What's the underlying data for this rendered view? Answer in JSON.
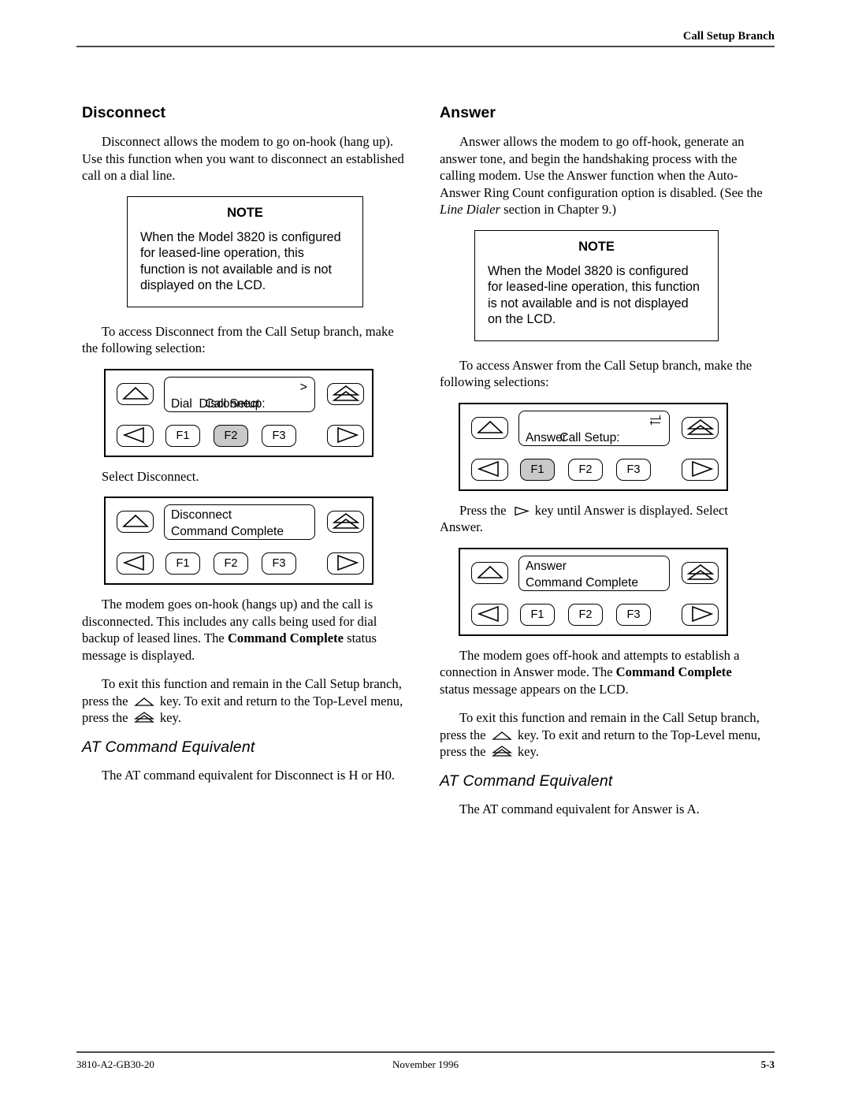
{
  "header": {
    "title": "Call Setup Branch"
  },
  "footer": {
    "doc_number": "3810-A2-GB30-20",
    "date": "November 1996",
    "page_number": "5-3"
  },
  "note_box": {
    "title": "NOTE",
    "text": "When the Model 3820 is configured for leased-line operation, this function is not available and is not displayed on the LCD."
  },
  "left_column": {
    "heading": "Disconnect",
    "intro": "Disconnect allows the modem to go on-hook (hang up). Use this function when you want to disconnect an established call on a dial line.",
    "access_text": "To access Disconnect from the Call Setup branch, make the following selection:",
    "panel1": {
      "lcd_line1": "Call Setup:",
      "lcd_line1_mark": ">",
      "lcd_line2": "Dial  Disconnect",
      "f1": "F1",
      "f2": "F2",
      "f3": "F3",
      "selected_key": "F2"
    },
    "select_text": "Select Disconnect.",
    "panel2": {
      "lcd_line1": "Disconnect",
      "lcd_line2": "Command Complete",
      "f1": "F1",
      "f2": "F2",
      "f3": "F3",
      "selected_key": ""
    },
    "result_before_bold": "The modem goes on-hook (hangs up) and the call is disconnected. This includes any calls being used for dial backup of leased lines. The ",
    "result_bold": "Command Complete",
    "result_after_bold": " status message is displayed.",
    "exit_part1": "To exit this function and remain in the Call Setup branch, press the ",
    "exit_part2": " key. To exit and return to the Top-Level menu, press the ",
    "exit_part3": " key.",
    "at_heading": "AT Command Equivalent",
    "at_text": "The AT command equivalent for Disconnect is H or H0."
  },
  "right_column": {
    "heading": "Answer",
    "intro_part1": "Answer allows the modem to go off-hook, generate an answer tone, and begin the handshaking process with the calling modem. Use the Answer function when the Auto-Answer Ring Count configuration option is disabled. (See the ",
    "intro_italic": "Line Dialer",
    "intro_part2": " section in Chapter 9.)",
    "access_text": "To access Answer from the Call Setup branch, make the following selections:",
    "panel1": {
      "lcd_line1": "Call Setup:",
      "lcd_line1_mark": "swap-icon",
      "lcd_line2": "Answer",
      "f1": "F1",
      "f2": "F2",
      "f3": "F3",
      "selected_key": "F1"
    },
    "press_part1": "Press the ",
    "press_part2": " key until Answer is displayed. Select Answer.",
    "panel2": {
      "lcd_line1": "Answer",
      "lcd_line2": "Command Complete",
      "f1": "F1",
      "f2": "F2",
      "f3": "F3",
      "selected_key": ""
    },
    "result_before_bold": "The modem goes off-hook and attempts to establish a connection in Answer mode. The ",
    "result_bold": "Command Complete",
    "result_after_bold": " status message appears on the LCD.",
    "exit_part1": "To exit this function and remain in the Call Setup branch, press the ",
    "exit_part2": " key. To exit and return to the Top-Level menu, press the ",
    "exit_part3": " key.",
    "at_heading": "AT Command Equivalent",
    "at_text": "The AT command equivalent for Answer is A."
  }
}
